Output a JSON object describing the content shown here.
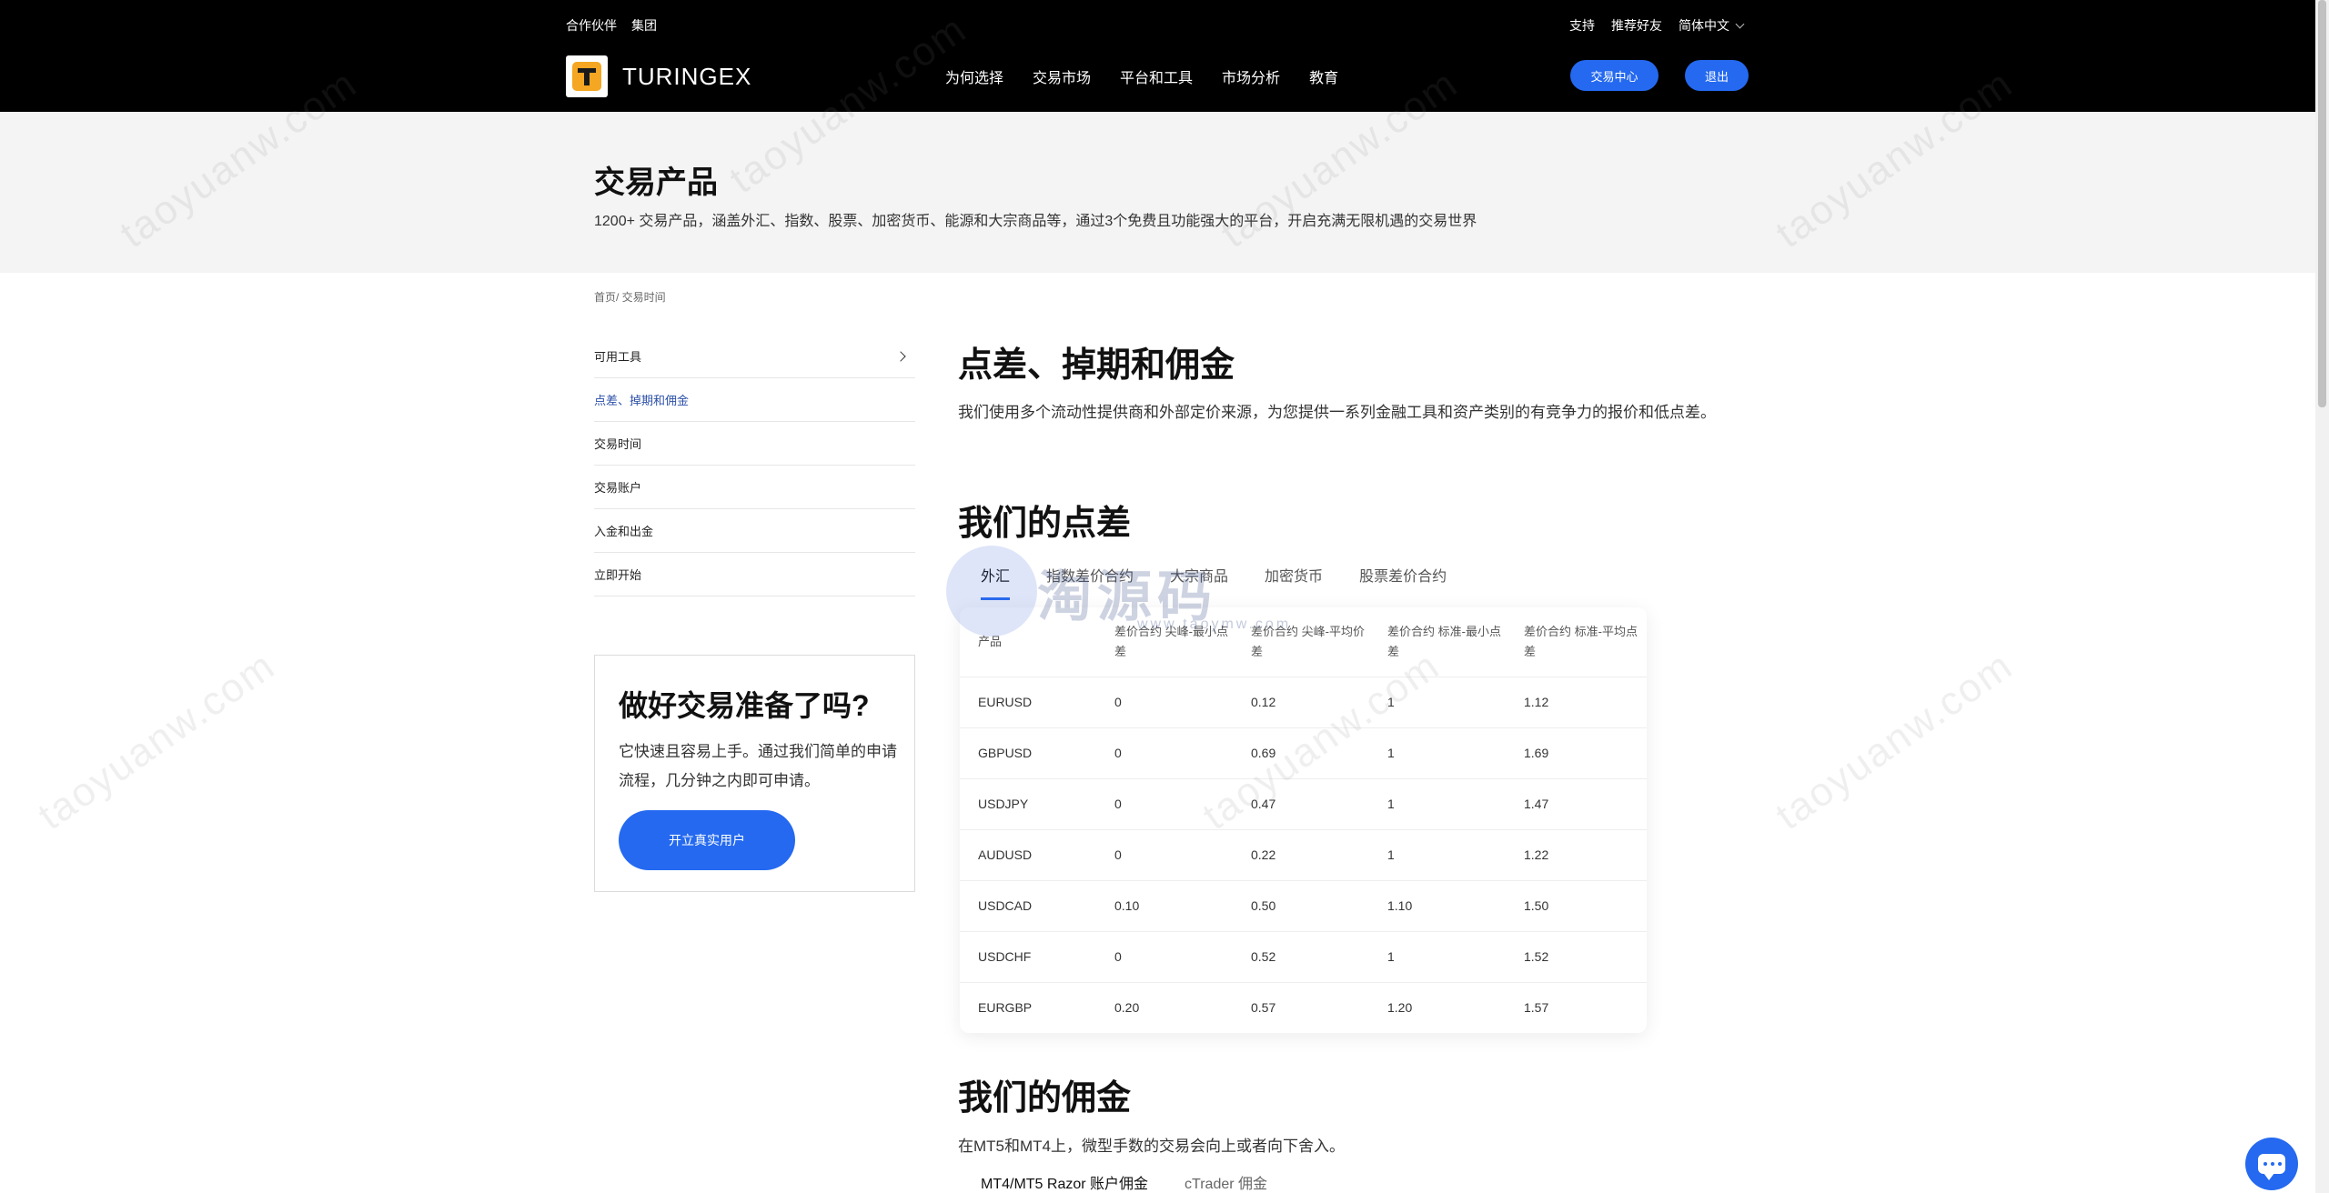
{
  "header": {
    "top_left_links": [
      "合作伙伴",
      "集团"
    ],
    "top_right_links": [
      "支持",
      "推荐好友"
    ],
    "language": "简体中文",
    "logo_text": "TURINGEX",
    "nav": [
      "为何选择",
      "交易市场",
      "平台和工具",
      "市场分析",
      "教育"
    ],
    "trade_center_button": "交易中心",
    "logout_button": "退出"
  },
  "hero": {
    "title": "交易产品",
    "subtitle": "1200+ 交易产品，涵盖外汇、指数、股票、加密货币、能源和大宗商品等，通过3个免费且功能强大的平台，开启充满无限机遇的交易世界"
  },
  "breadcrumb": "首页/ 交易时间",
  "sidebar": {
    "items": [
      {
        "label": "可用工具",
        "active": false,
        "has_chevron": true
      },
      {
        "label": "点差、掉期和佣金",
        "active": true,
        "has_chevron": false
      },
      {
        "label": "交易时间",
        "active": false,
        "has_chevron": false
      },
      {
        "label": "交易账户",
        "active": false,
        "has_chevron": false
      },
      {
        "label": "入金和出金",
        "active": false,
        "has_chevron": false
      },
      {
        "label": "立即开始",
        "active": false,
        "has_chevron": false
      }
    ]
  },
  "cta": {
    "title": "做好交易准备了吗?",
    "text": "它快速且容易上手。通过我们简单的申请流程，几分钟之内即可申请。",
    "button": "开立真实用户"
  },
  "main": {
    "title": "点差、掉期和佣金",
    "intro": "我们使用多个流动性提供商和外部定价来源，为您提供一系列金融工具和资产类别的有竞争力的报价和低点差。",
    "spreads_title": "我们的点差",
    "tabs": [
      "外汇",
      "指数差价合约",
      "大宗商品",
      "加密货币",
      "股票差价合约"
    ],
    "active_tab": 0,
    "table": {
      "headers": [
        "产品",
        "差价合约 尖峰-最小点差",
        "差价合约 尖峰-平均价差",
        "差价合约 标准-最小点差",
        "差价合约 标准-平均点差"
      ],
      "rows": [
        [
          "EURUSD",
          "0",
          "0.12",
          "1",
          "1.12"
        ],
        [
          "GBPUSD",
          "0",
          "0.69",
          "1",
          "1.69"
        ],
        [
          "USDJPY",
          "0",
          "0.47",
          "1",
          "1.47"
        ],
        [
          "AUDUSD",
          "0",
          "0.22",
          "1",
          "1.22"
        ],
        [
          "USDCAD",
          "0.10",
          "0.50",
          "1.10",
          "1.50"
        ],
        [
          "USDCHF",
          "0",
          "0.52",
          "1",
          "1.52"
        ],
        [
          "EURGBP",
          "0.20",
          "0.57",
          "1.20",
          "1.57"
        ]
      ]
    },
    "commission_title": "我们的佣金",
    "commission_intro": "在MT5和MT4上，微型手数的交易会向上或者向下舍入。",
    "commission_tabs": [
      "MT4/MT5 Razor 账户佣金",
      "cTrader 佣金"
    ]
  },
  "watermark": {
    "text": "taoyuanw.com",
    "brand": "淘源码",
    "brand_sub": "www.taoymw.com"
  },
  "colors": {
    "accent": "#2469f0",
    "header_bg": "#000000",
    "hero_bg": "#f4f4f5",
    "active_link": "#2b4fa8"
  }
}
